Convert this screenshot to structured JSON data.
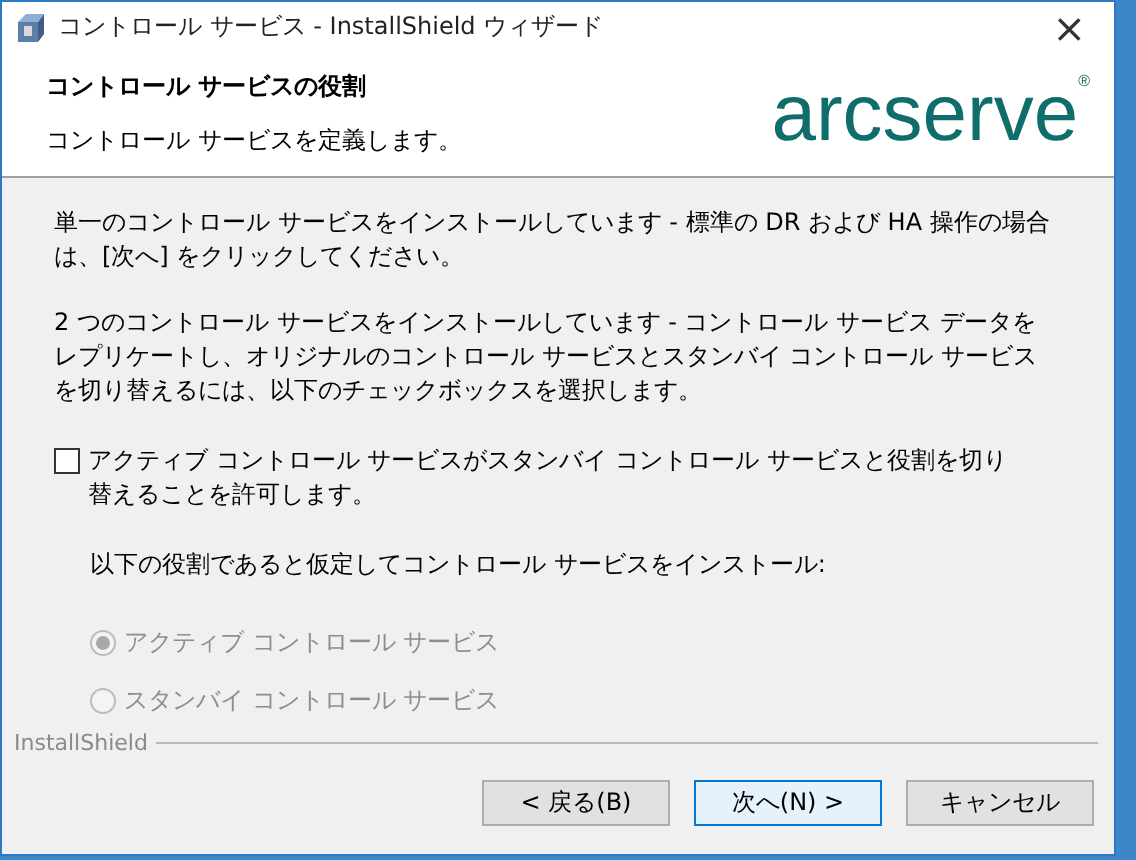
{
  "window": {
    "title": "コントロール サービス - InstallShield ウィザード",
    "close": "×"
  },
  "header": {
    "title": "コントロール サービスの役割",
    "subtitle": "コントロール サービスを定義します。",
    "logo": "arcserve",
    "logo_mark": "®"
  },
  "paragraphs": [
    "単一のコントロール サービスをインストールしています - 標準の DR および HA 操作の場合は、[次へ] をクリックしてください。",
    "2 つのコントロール サービスをインストールしています - コントロール サービス データをレプリケートし、オリジナルのコントロール サービスとスタンバイ コントロール サービスを切り替えるには、以下のチェックボックスを選択します。"
  ],
  "checkbox": {
    "label": "アクティブ コントロール サービスがスタンバイ コントロール サービスと役割を切り替えることを許可します。",
    "checked": false
  },
  "role_prompt": "以下の役割であると仮定してコントロール サービスをインストール:",
  "roles": [
    {
      "label": "アクティブ コントロール サービス",
      "selected": true,
      "disabled": true
    },
    {
      "label": "スタンバイ コントロール サービス",
      "selected": false,
      "disabled": true
    }
  ],
  "footer_brand": "InstallShield",
  "buttons": [
    {
      "label": "< 戻る(B)",
      "focused": false
    },
    {
      "label": "次へ(N) >",
      "focused": true
    },
    {
      "label": "キャンセル",
      "focused": false
    }
  ]
}
